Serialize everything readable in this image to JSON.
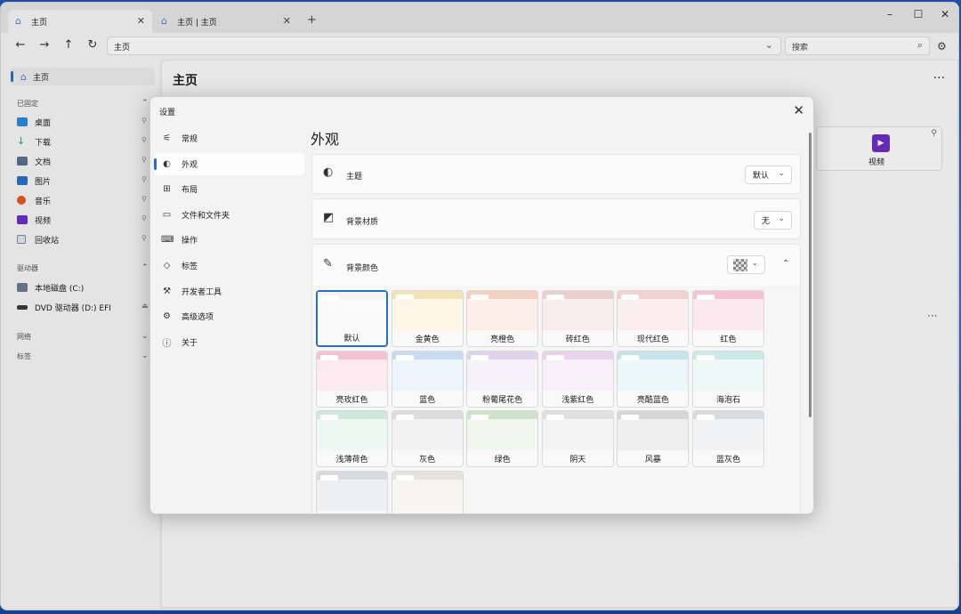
{
  "tabs": [
    {
      "label": "主页",
      "active": true
    },
    {
      "label": "主页 | 主页",
      "active": false
    }
  ],
  "window_controls": {
    "minimize": "–",
    "maximize": "☐",
    "close": "✕"
  },
  "address": {
    "path": "主页",
    "search_placeholder": "搜索"
  },
  "sidebar": {
    "home": "主页",
    "pinned_section": "已固定",
    "pinned": [
      {
        "label": "桌面",
        "icon": "desktop-icon",
        "color": "#2a8bd8"
      },
      {
        "label": "下载",
        "icon": "download-icon",
        "color": "#1f9d8a"
      },
      {
        "label": "文档",
        "icon": "document-icon",
        "color": "#5a6f8a"
      },
      {
        "label": "图片",
        "icon": "pictures-icon",
        "color": "#2a6fc5"
      },
      {
        "label": "音乐",
        "icon": "music-icon",
        "color": "#e0592a"
      },
      {
        "label": "视频",
        "icon": "video-icon",
        "color": "#6d2ec2"
      },
      {
        "label": "回收站",
        "icon": "recycle-bin-icon",
        "color": "#7a8aa0"
      }
    ],
    "drives_section": "驱动器",
    "drives": [
      {
        "label": "本地磁盘 (C:)",
        "icon": "drive-icon"
      },
      {
        "label": "DVD 驱动器 (D:) EFI",
        "icon": "dvd-icon"
      }
    ],
    "network_section": "网络",
    "tags_section": "标签"
  },
  "main": {
    "title": "主页",
    "video_card": "视频"
  },
  "settings": {
    "title": "设置",
    "nav": [
      {
        "label": "常规",
        "icon": "sliders-icon",
        "glyph": "⚟"
      },
      {
        "label": "外观",
        "icon": "palette-icon",
        "glyph": "◐",
        "selected": true
      },
      {
        "label": "布局",
        "icon": "layout-icon",
        "glyph": "⊞"
      },
      {
        "label": "文件和文件夹",
        "icon": "folder-icon",
        "glyph": "▭"
      },
      {
        "label": "操作",
        "icon": "actions-icon",
        "glyph": "⌨"
      },
      {
        "label": "标签",
        "icon": "tag-icon",
        "glyph": "◇"
      },
      {
        "label": "开发者工具",
        "icon": "dev-tools-icon",
        "glyph": "⚒"
      },
      {
        "label": "高级选项",
        "icon": "advanced-icon",
        "glyph": "⚙"
      },
      {
        "label": "关于",
        "icon": "info-icon",
        "glyph": "ⓘ"
      }
    ],
    "pane_title": "外观",
    "theme": {
      "label": "主题",
      "value": "默认"
    },
    "backdrop": {
      "label": "背景材质",
      "value": "无"
    },
    "bgcolor": {
      "label": "背景颜色"
    },
    "colors": [
      {
        "name": "默认",
        "band": "#f4f4f4",
        "body": "#fafafa",
        "selected": true
      },
      {
        "name": "金黄色",
        "band": "#f5e3b8",
        "body": "#fdf6e6"
      },
      {
        "name": "亮橙色",
        "band": "#f3d2c4",
        "body": "#fcefe9"
      },
      {
        "name": "砖红色",
        "band": "#ebcfcf",
        "body": "#f8eded"
      },
      {
        "name": "现代红色",
        "band": "#f1d2d2",
        "body": "#fbeeee"
      },
      {
        "name": "红色",
        "band": "#f2c3d3",
        "body": "#fce9f0"
      },
      {
        "name": "亮玫红色",
        "band": "#f3c3d3",
        "body": "#fdeaf1"
      },
      {
        "name": "蓝色",
        "band": "#c9dbf1",
        "body": "#eef4fb"
      },
      {
        "name": "粉葡尾花色",
        "band": "#ddd3ea",
        "body": "#f5f2fa"
      },
      {
        "name": "浅紫红色",
        "band": "#ead2ea",
        "body": "#f9eff9"
      },
      {
        "name": "亮酷蓝色",
        "band": "#c8e4ea",
        "body": "#ecf7f9"
      },
      {
        "name": "海泡石",
        "band": "#cbeae6",
        "body": "#eef9f7"
      },
      {
        "name": "浅薄荷色",
        "band": "#cde9de",
        "body": "#eef8f3"
      },
      {
        "name": "灰色",
        "band": "#dcdcdc",
        "body": "#f2f2f2"
      },
      {
        "name": "绿色",
        "band": "#cfe3cc",
        "body": "#f1f7ef"
      },
      {
        "name": "阴天",
        "band": "#e0e0e0",
        "body": "#f4f4f4"
      },
      {
        "name": "风暴",
        "band": "#d6d6d6",
        "body": "#efefef"
      },
      {
        "name": "蓝灰色",
        "band": "#d9dcdf",
        "body": "#f1f2f3"
      },
      {
        "name": "",
        "band": "#d8dade",
        "body": "#eeeff1"
      },
      {
        "name": "",
        "band": "#e6e3de",
        "body": "#f6f5f2"
      }
    ]
  }
}
